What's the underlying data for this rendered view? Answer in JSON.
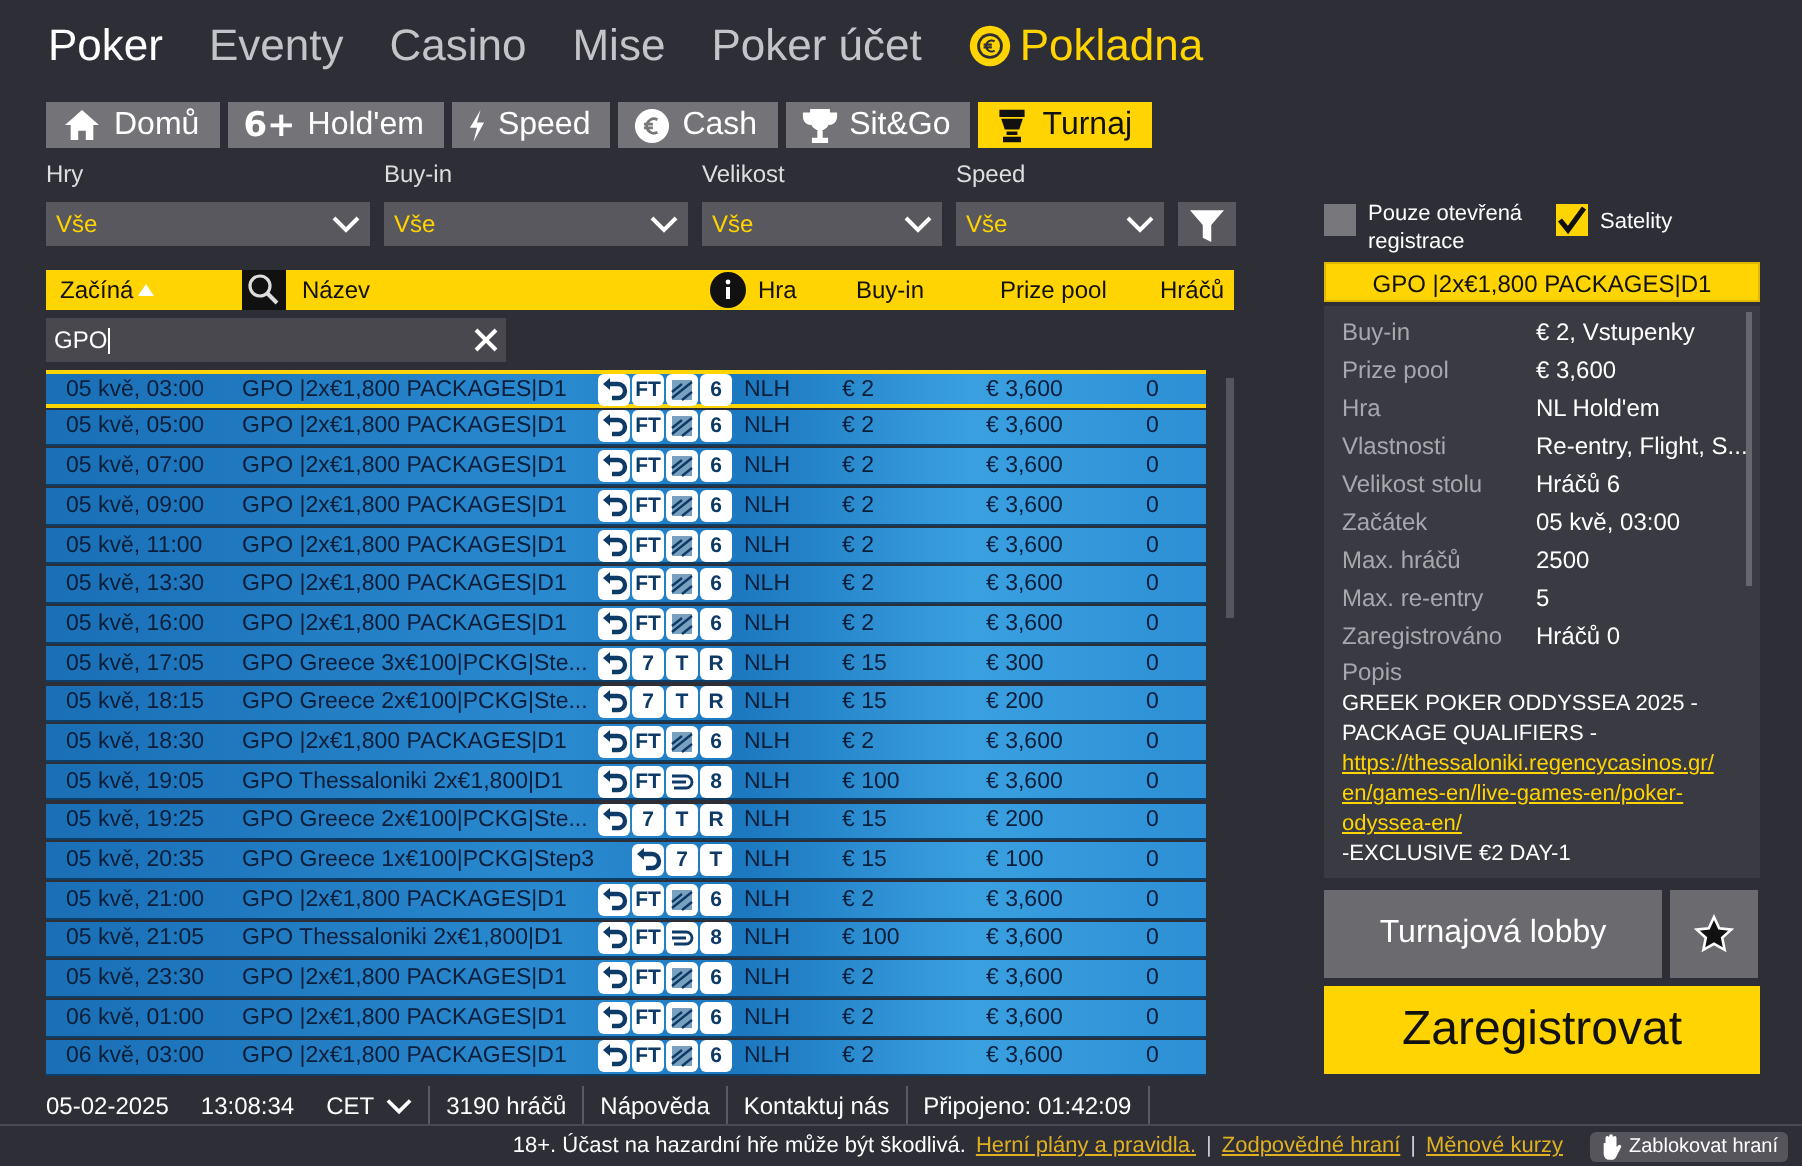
{
  "nav": [
    {
      "label": "Poker",
      "selected": true,
      "kind": "link"
    },
    {
      "label": "Eventy",
      "selected": false,
      "kind": "link"
    },
    {
      "label": "Casino",
      "selected": false,
      "kind": "link"
    },
    {
      "label": "Mise",
      "selected": false,
      "kind": "link"
    },
    {
      "label": "Poker účet",
      "selected": false,
      "kind": "link"
    },
    {
      "label": "Pokladna",
      "selected": false,
      "kind": "cashier"
    }
  ],
  "tabs": [
    {
      "label": "Domů",
      "kind": "home",
      "selected": false
    },
    {
      "label": "Hold'em",
      "kind": "sixplus",
      "icon_text": "6+",
      "selected": false
    },
    {
      "label": "Speed",
      "kind": "bolt",
      "selected": false
    },
    {
      "label": "Cash",
      "kind": "euro",
      "selected": false
    },
    {
      "label": "Sit&Go",
      "kind": "trophy",
      "selected": false
    },
    {
      "label": "Turnaj",
      "kind": "cup",
      "selected": true
    }
  ],
  "filters": [
    {
      "label": "Hry",
      "value": "Vše"
    },
    {
      "label": "Buy-in",
      "value": "Vše"
    },
    {
      "label": "Velikost",
      "value": "Vše"
    },
    {
      "label": "Speed",
      "value": "Vše"
    }
  ],
  "checkboxes": [
    {
      "label": "Pouze otevřená registrace",
      "checked": false
    },
    {
      "label": "Satelity",
      "checked": true
    }
  ],
  "table": {
    "columns": {
      "start": "Začíná",
      "name": "Název",
      "game": "Hra",
      "buyin": "Buy-in",
      "prize": "Prize pool",
      "players": "Hráčů"
    },
    "search": {
      "value": "GPO"
    },
    "rows": [
      {
        "start": "05 kvě, 03:00",
        "name": "GPO |2x€1,800 PACKAGES|D1",
        "badges": [
          {
            "kind": "reentry"
          },
          {
            "kind": "text",
            "text": "FT"
          },
          {
            "kind": "chart"
          },
          {
            "kind": "text",
            "text": "6"
          }
        ],
        "game": "NLH",
        "buyin": "€ 2",
        "prize": "€ 3,600",
        "players": "0",
        "selected": true
      },
      {
        "start": "05 kvě, 05:00",
        "name": "GPO |2x€1,800 PACKAGES|D1",
        "badges": [
          {
            "kind": "reentry"
          },
          {
            "kind": "text",
            "text": "FT"
          },
          {
            "kind": "chart"
          },
          {
            "kind": "text",
            "text": "6"
          }
        ],
        "game": "NLH",
        "buyin": "€ 2",
        "prize": "€ 3,600",
        "players": "0",
        "selected": false
      },
      {
        "start": "05 kvě, 07:00",
        "name": "GPO |2x€1,800 PACKAGES|D1",
        "badges": [
          {
            "kind": "reentry"
          },
          {
            "kind": "text",
            "text": "FT"
          },
          {
            "kind": "chart"
          },
          {
            "kind": "text",
            "text": "6"
          }
        ],
        "game": "NLH",
        "buyin": "€ 2",
        "prize": "€ 3,600",
        "players": "0",
        "selected": false
      },
      {
        "start": "05 kvě, 09:00",
        "name": "GPO |2x€1,800 PACKAGES|D1",
        "badges": [
          {
            "kind": "reentry"
          },
          {
            "kind": "text",
            "text": "FT"
          },
          {
            "kind": "chart"
          },
          {
            "kind": "text",
            "text": "6"
          }
        ],
        "game": "NLH",
        "buyin": "€ 2",
        "prize": "€ 3,600",
        "players": "0",
        "selected": false
      },
      {
        "start": "05 kvě, 11:00",
        "name": "GPO |2x€1,800 PACKAGES|D1",
        "badges": [
          {
            "kind": "reentry"
          },
          {
            "kind": "text",
            "text": "FT"
          },
          {
            "kind": "chart"
          },
          {
            "kind": "text",
            "text": "6"
          }
        ],
        "game": "NLH",
        "buyin": "€ 2",
        "prize": "€ 3,600",
        "players": "0",
        "selected": false
      },
      {
        "start": "05 kvě, 13:30",
        "name": "GPO |2x€1,800 PACKAGES|D1",
        "badges": [
          {
            "kind": "reentry"
          },
          {
            "kind": "text",
            "text": "FT"
          },
          {
            "kind": "chart"
          },
          {
            "kind": "text",
            "text": "6"
          }
        ],
        "game": "NLH",
        "buyin": "€ 2",
        "prize": "€ 3,600",
        "players": "0",
        "selected": false
      },
      {
        "start": "05 kvě, 16:00",
        "name": "GPO |2x€1,800 PACKAGES|D1",
        "badges": [
          {
            "kind": "reentry"
          },
          {
            "kind": "text",
            "text": "FT"
          },
          {
            "kind": "chart"
          },
          {
            "kind": "text",
            "text": "6"
          }
        ],
        "game": "NLH",
        "buyin": "€ 2",
        "prize": "€ 3,600",
        "players": "0",
        "selected": false
      },
      {
        "start": "05 kvě, 17:05",
        "name": "GPO Greece 3x€100|PCKG|Ste...",
        "badges": [
          {
            "kind": "reentry"
          },
          {
            "kind": "text",
            "text": "7"
          },
          {
            "kind": "text",
            "text": "T"
          },
          {
            "kind": "text",
            "text": "R"
          }
        ],
        "game": "NLH",
        "buyin": "€ 15",
        "prize": "€ 300",
        "players": "0",
        "selected": false
      },
      {
        "start": "05 kvě, 18:15",
        "name": "GPO Greece 2x€100|PCKG|Ste...",
        "badges": [
          {
            "kind": "reentry"
          },
          {
            "kind": "text",
            "text": "7"
          },
          {
            "kind": "text",
            "text": "T"
          },
          {
            "kind": "text",
            "text": "R"
          }
        ],
        "game": "NLH",
        "buyin": "€ 15",
        "prize": "€ 200",
        "players": "0",
        "selected": false
      },
      {
        "start": "05 kvě, 18:30",
        "name": "GPO |2x€1,800 PACKAGES|D1",
        "badges": [
          {
            "kind": "reentry"
          },
          {
            "kind": "text",
            "text": "FT"
          },
          {
            "kind": "chart"
          },
          {
            "kind": "text",
            "text": "6"
          }
        ],
        "game": "NLH",
        "buyin": "€ 2",
        "prize": "€ 3,600",
        "players": "0",
        "selected": false
      },
      {
        "start": "05 kvě, 19:05",
        "name": "GPO Thessaloniki 2x€1,800|D1",
        "badges": [
          {
            "kind": "reentry"
          },
          {
            "kind": "text",
            "text": "FT"
          },
          {
            "kind": "swirl"
          },
          {
            "kind": "text",
            "text": "8"
          }
        ],
        "game": "NLH",
        "buyin": "€ 100",
        "prize": "€ 3,600",
        "players": "0",
        "selected": false
      },
      {
        "start": "05 kvě, 19:25",
        "name": "GPO Greece 2x€100|PCKG|Ste...",
        "badges": [
          {
            "kind": "reentry"
          },
          {
            "kind": "text",
            "text": "7"
          },
          {
            "kind": "text",
            "text": "T"
          },
          {
            "kind": "text",
            "text": "R"
          }
        ],
        "game": "NLH",
        "buyin": "€ 15",
        "prize": "€ 200",
        "players": "0",
        "selected": false
      },
      {
        "start": "05 kvě, 20:35",
        "name": "GPO Greece 1x€100|PCKG|Step3",
        "badges": [
          {
            "kind": "reentry"
          },
          {
            "kind": "text",
            "text": "7"
          },
          {
            "kind": "text",
            "text": "T"
          }
        ],
        "game": "NLH",
        "buyin": "€ 15",
        "prize": "€ 100",
        "players": "0",
        "selected": false
      },
      {
        "start": "05 kvě, 21:00",
        "name": "GPO |2x€1,800 PACKAGES|D1",
        "badges": [
          {
            "kind": "reentry"
          },
          {
            "kind": "text",
            "text": "FT"
          },
          {
            "kind": "chart"
          },
          {
            "kind": "text",
            "text": "6"
          }
        ],
        "game": "NLH",
        "buyin": "€ 2",
        "prize": "€ 3,600",
        "players": "0",
        "selected": false
      },
      {
        "start": "05 kvě, 21:05",
        "name": "GPO Thessaloniki 2x€1,800|D1",
        "badges": [
          {
            "kind": "reentry"
          },
          {
            "kind": "text",
            "text": "FT"
          },
          {
            "kind": "swirl"
          },
          {
            "kind": "text",
            "text": "8"
          }
        ],
        "game": "NLH",
        "buyin": "€ 100",
        "prize": "€ 3,600",
        "players": "0",
        "selected": false
      },
      {
        "start": "05 kvě, 23:30",
        "name": "GPO |2x€1,800 PACKAGES|D1",
        "badges": [
          {
            "kind": "reentry"
          },
          {
            "kind": "text",
            "text": "FT"
          },
          {
            "kind": "chart"
          },
          {
            "kind": "text",
            "text": "6"
          }
        ],
        "game": "NLH",
        "buyin": "€ 2",
        "prize": "€ 3,600",
        "players": "0",
        "selected": false
      },
      {
        "start": "06 kvě, 01:00",
        "name": "GPO |2x€1,800 PACKAGES|D1",
        "badges": [
          {
            "kind": "reentry"
          },
          {
            "kind": "text",
            "text": "FT"
          },
          {
            "kind": "chart"
          },
          {
            "kind": "text",
            "text": "6"
          }
        ],
        "game": "NLH",
        "buyin": "€ 2",
        "prize": "€ 3,600",
        "players": "0",
        "selected": false
      },
      {
        "start": "06 kvě, 03:00",
        "name": "GPO |2x€1,800 PACKAGES|D1",
        "badges": [
          {
            "kind": "reentry"
          },
          {
            "kind": "text",
            "text": "FT"
          },
          {
            "kind": "chart"
          },
          {
            "kind": "text",
            "text": "6"
          }
        ],
        "game": "NLH",
        "buyin": "€ 2",
        "prize": "€ 3,600",
        "players": "0",
        "selected": false
      }
    ]
  },
  "status_bar": {
    "date": "05-02-2025",
    "time": "13:08:34",
    "timezone": "CET",
    "players": "3190 hráčů",
    "items": [
      "Nápověda",
      "Kontaktuj nás"
    ],
    "connected": "Připojeno: 01:42:09"
  },
  "details": {
    "title": "GPO |2x€1,800 PACKAGES|D1",
    "properties": [
      {
        "label": "Buy-in",
        "value": "€ 2, Vstupenky"
      },
      {
        "label": "Prize pool",
        "value": "€ 3,600"
      },
      {
        "label": "Hra",
        "value": "NL Hold'em"
      },
      {
        "label": "Vlastnosti",
        "value": "Re-entry, Flight, S..."
      },
      {
        "label": "Velikost stolu",
        "value": "Hráčů 6"
      },
      {
        "label": "Začátek",
        "value": "05 kvě, 03:00"
      },
      {
        "label": "Max. hráčů",
        "value": "2500"
      },
      {
        "label": "Max. re-entry",
        "value": "5"
      },
      {
        "label": "Zaregistrováno",
        "value": "Hráčů 0"
      }
    ],
    "description_label": "Popis",
    "description": {
      "before": "GREEK POKER ODDYSSEA 2025 - PACKAGE QUALIFIERS - ",
      "link": "https://thessaloniki.regencycasinos.gr/en/games-en/live-games-en/poker-odyssea-en/",
      "after": " -EXCLUSIVE €2 DAY-1"
    }
  },
  "buttons": {
    "lobby": "Turnajová lobby",
    "register": "Zaregistrovat"
  },
  "footer": {
    "notice": "18+. Účast na hazardní hře může být škodlivá.",
    "links": [
      "Herní plány a pravidla.",
      "Zodpovědné hraní",
      "Měnové kurzy"
    ],
    "separator": "|",
    "block_button": "Zablokovat hraní"
  }
}
